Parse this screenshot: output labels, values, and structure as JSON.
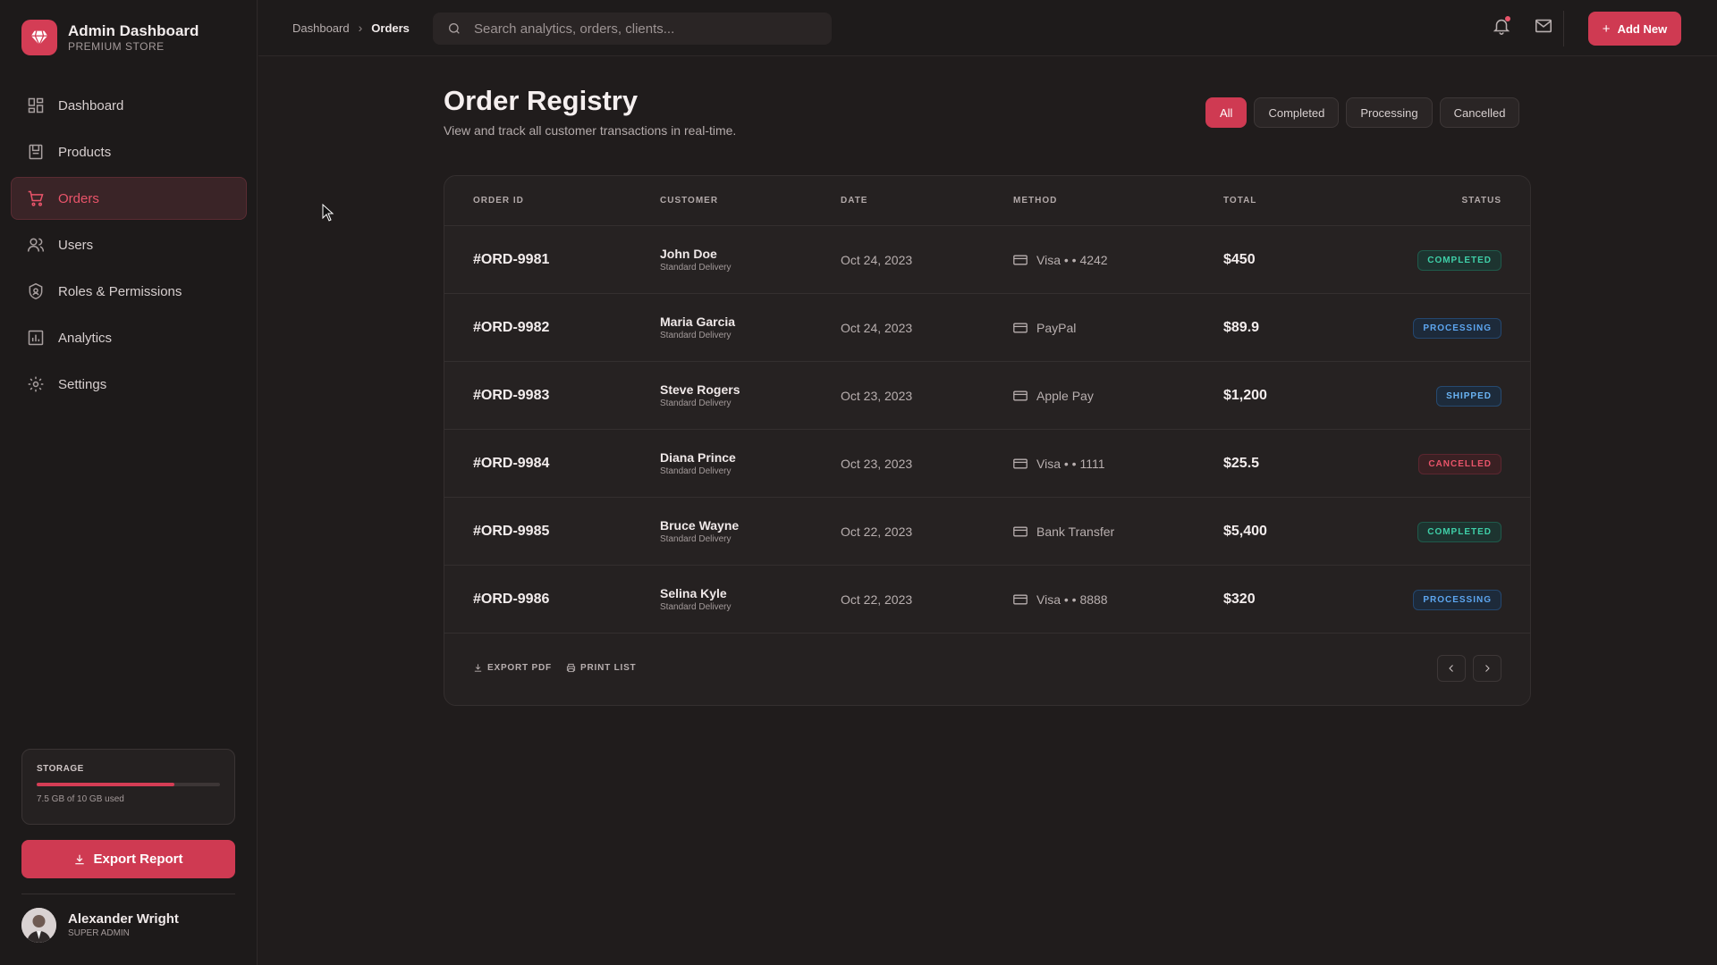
{
  "brand": {
    "title": "Admin Dashboard",
    "subtitle": "PREMIUM STORE"
  },
  "sidebar": {
    "items": [
      {
        "label": "Dashboard",
        "icon": "grid-icon"
      },
      {
        "label": "Products",
        "icon": "box-icon"
      },
      {
        "label": "Orders",
        "icon": "cart-icon",
        "active": true
      },
      {
        "label": "Users",
        "icon": "users-icon"
      },
      {
        "label": "Roles & Permissions",
        "icon": "shield-icon"
      },
      {
        "label": "Analytics",
        "icon": "chart-icon"
      },
      {
        "label": "Settings",
        "icon": "gear-icon"
      }
    ],
    "storage": {
      "title": "STORAGE",
      "text": "7.5 GB of 10 GB used",
      "used_fraction": 0.75
    },
    "export_label": "Export Report",
    "user": {
      "name": "Alexander Wright",
      "role": "SUPER ADMIN"
    }
  },
  "topbar": {
    "breadcrumb": {
      "parent": "Dashboard",
      "current": "Orders"
    },
    "search_placeholder": "Search analytics, orders, clients...",
    "add_label": "Add New"
  },
  "main": {
    "title": "Order Registry",
    "subtitle": "View and track all customer transactions in real-time.",
    "filters": [
      "All",
      "Completed",
      "Processing",
      "Cancelled"
    ],
    "active_filter": "All",
    "columns": [
      "ORDER ID",
      "CUSTOMER",
      "DATE",
      "METHOD",
      "TOTAL",
      "STATUS"
    ],
    "orders": [
      {
        "id": "#ORD-9981",
        "customer": "John Doe",
        "delivery": "Standard Delivery",
        "date": "Oct 24, 2023",
        "method": "Visa • • 4242",
        "total": "$450",
        "status": "COMPLETED"
      },
      {
        "id": "#ORD-9982",
        "customer": "Maria Garcia",
        "delivery": "Standard Delivery",
        "date": "Oct 24, 2023",
        "method": "PayPal",
        "total": "$89.9",
        "status": "PROCESSING"
      },
      {
        "id": "#ORD-9983",
        "customer": "Steve Rogers",
        "delivery": "Standard Delivery",
        "date": "Oct 23, 2023",
        "method": "Apple Pay",
        "total": "$1,200",
        "status": "SHIPPED"
      },
      {
        "id": "#ORD-9984",
        "customer": "Diana Prince",
        "delivery": "Standard Delivery",
        "date": "Oct 23, 2023",
        "method": "Visa • • 1111",
        "total": "$25.5",
        "status": "CANCELLED"
      },
      {
        "id": "#ORD-9985",
        "customer": "Bruce Wayne",
        "delivery": "Standard Delivery",
        "date": "Oct 22, 2023",
        "method": "Bank Transfer",
        "total": "$5,400",
        "status": "COMPLETED"
      },
      {
        "id": "#ORD-9986",
        "customer": "Selina Kyle",
        "delivery": "Standard Delivery",
        "date": "Oct 22, 2023",
        "method": "Visa • • 8888",
        "total": "$320",
        "status": "PROCESSING"
      }
    ],
    "footer": {
      "export_pdf": "EXPORT PDF",
      "print_list": "PRINT LIST"
    }
  },
  "colors": {
    "accent": "#cf3a52",
    "completed": "#3fcfa8",
    "processing": "#5da6f0",
    "cancelled": "#e9546a"
  }
}
